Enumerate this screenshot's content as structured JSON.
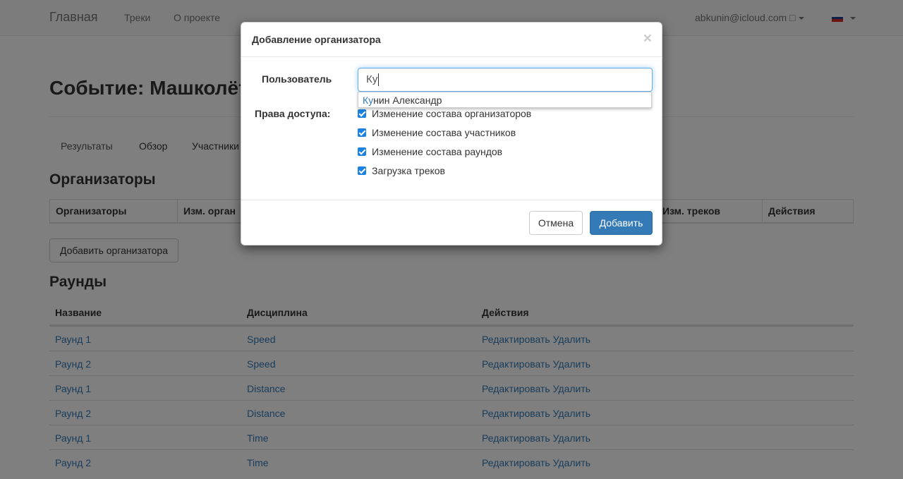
{
  "navbar": {
    "brand": "Главная",
    "links": [
      "Треки",
      "О проекте"
    ],
    "user": "abkunin@icloud.com □"
  },
  "page": {
    "title": "Событие: Машколёт",
    "tabs": [
      "Результаты",
      "Обзор",
      "Участники"
    ],
    "organizers_heading": "Организаторы",
    "organizers_table": {
      "headers": [
        "Организаторы",
        "Изм. орган",
        "Изм. треков",
        "Действия"
      ]
    },
    "add_organizer_button": "Добавить организатора",
    "rounds_heading": "Раунды",
    "rounds_table": {
      "headers": [
        "Название",
        "Дисциплина",
        "Действия"
      ],
      "rows": [
        {
          "name": "Раунд 1",
          "discipline": "Speed",
          "actions": "Редактировать Удалить"
        },
        {
          "name": "Раунд 2",
          "discipline": "Speed",
          "actions": "Редактировать Удалить"
        },
        {
          "name": "Раунд 1",
          "discipline": "Distance",
          "actions": "Редактировать Удалить"
        },
        {
          "name": "Раунд 2",
          "discipline": "Distance",
          "actions": "Редактировать Удалить"
        },
        {
          "name": "Раунд 1",
          "discipline": "Time",
          "actions": "Редактировать Удалить"
        },
        {
          "name": "Раунд 2",
          "discipline": "Time",
          "actions": "Редактировать Удалить"
        }
      ]
    }
  },
  "modal": {
    "title": "Добавление организатора",
    "close": "×",
    "user_label": "Пользователь",
    "user_value": "Ку",
    "suggestion": {
      "match": "Ку",
      "rest": "нин Александр"
    },
    "access_label": "Права доступа:",
    "permissions": [
      {
        "label": "Изменение состава организаторов",
        "checked": true
      },
      {
        "label": "Изменение состава участников",
        "checked": true
      },
      {
        "label": "Изменение состава раундов",
        "checked": true
      },
      {
        "label": "Загрузка треков",
        "checked": true
      }
    ],
    "cancel_button": "Отмена",
    "add_button": "Добавить"
  }
}
